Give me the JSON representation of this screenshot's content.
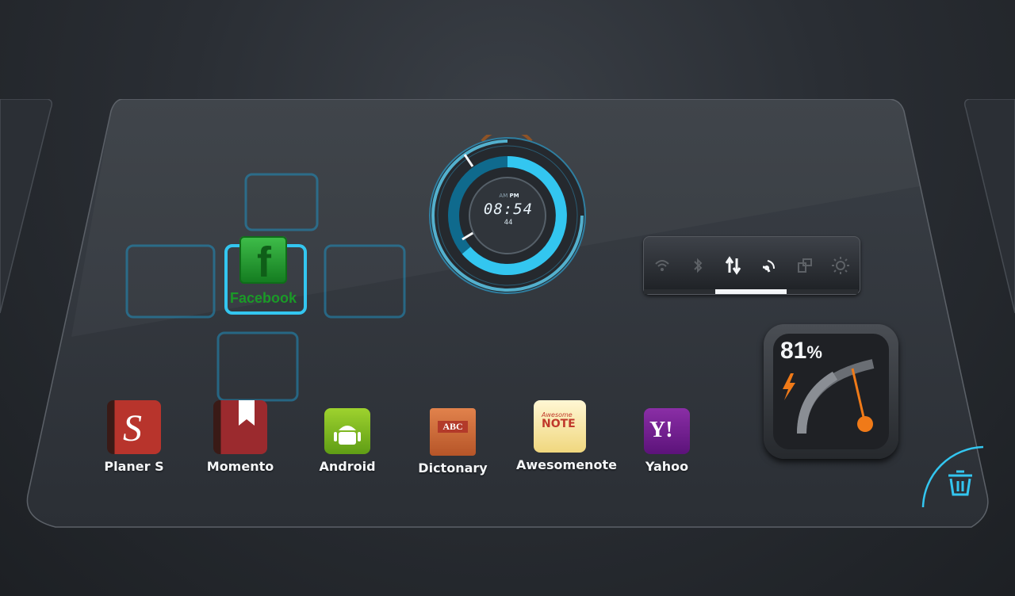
{
  "clock": {
    "am": "AM",
    "pm": "PM",
    "time": "08:54",
    "seconds": "44"
  },
  "facebook": {
    "label": "Facebook",
    "letter": "f",
    "icon": "facebook-icon"
  },
  "toggles": [
    {
      "name": "wifi",
      "icon": "wifi-icon",
      "on": false
    },
    {
      "name": "bluetooth",
      "icon": "bluetooth-icon",
      "on": false
    },
    {
      "name": "data",
      "icon": "data-transfer-icon",
      "on": true
    },
    {
      "name": "gps",
      "icon": "gps-icon",
      "on": true
    },
    {
      "name": "rotation",
      "icon": "screen-rotation-icon",
      "on": false
    },
    {
      "name": "brightness",
      "icon": "brightness-icon",
      "on": false
    }
  ],
  "battery": {
    "percent_value": "81",
    "percent_sign": "%",
    "level": 0.81
  },
  "apps": [
    {
      "label": "Planer S",
      "icon": "planer-s-icon",
      "glyph": "S"
    },
    {
      "label": "Momento",
      "icon": "momento-icon"
    },
    {
      "label": "Android",
      "icon": "android-icon"
    },
    {
      "label": "Dictonary",
      "icon": "dictionary-icon",
      "glyph": "ABC"
    },
    {
      "label": "Awesomenote",
      "icon": "awesomenote-icon",
      "glyph_top": "Awesome",
      "glyph_main": "NOTE"
    },
    {
      "label": "Yahoo",
      "icon": "yahoo-icon",
      "glyph": "Y!"
    }
  ],
  "colors": {
    "accent_cyan": "#33c6f0",
    "facebook_green": "#1a9a27",
    "battery_needle": "#f07a18"
  }
}
